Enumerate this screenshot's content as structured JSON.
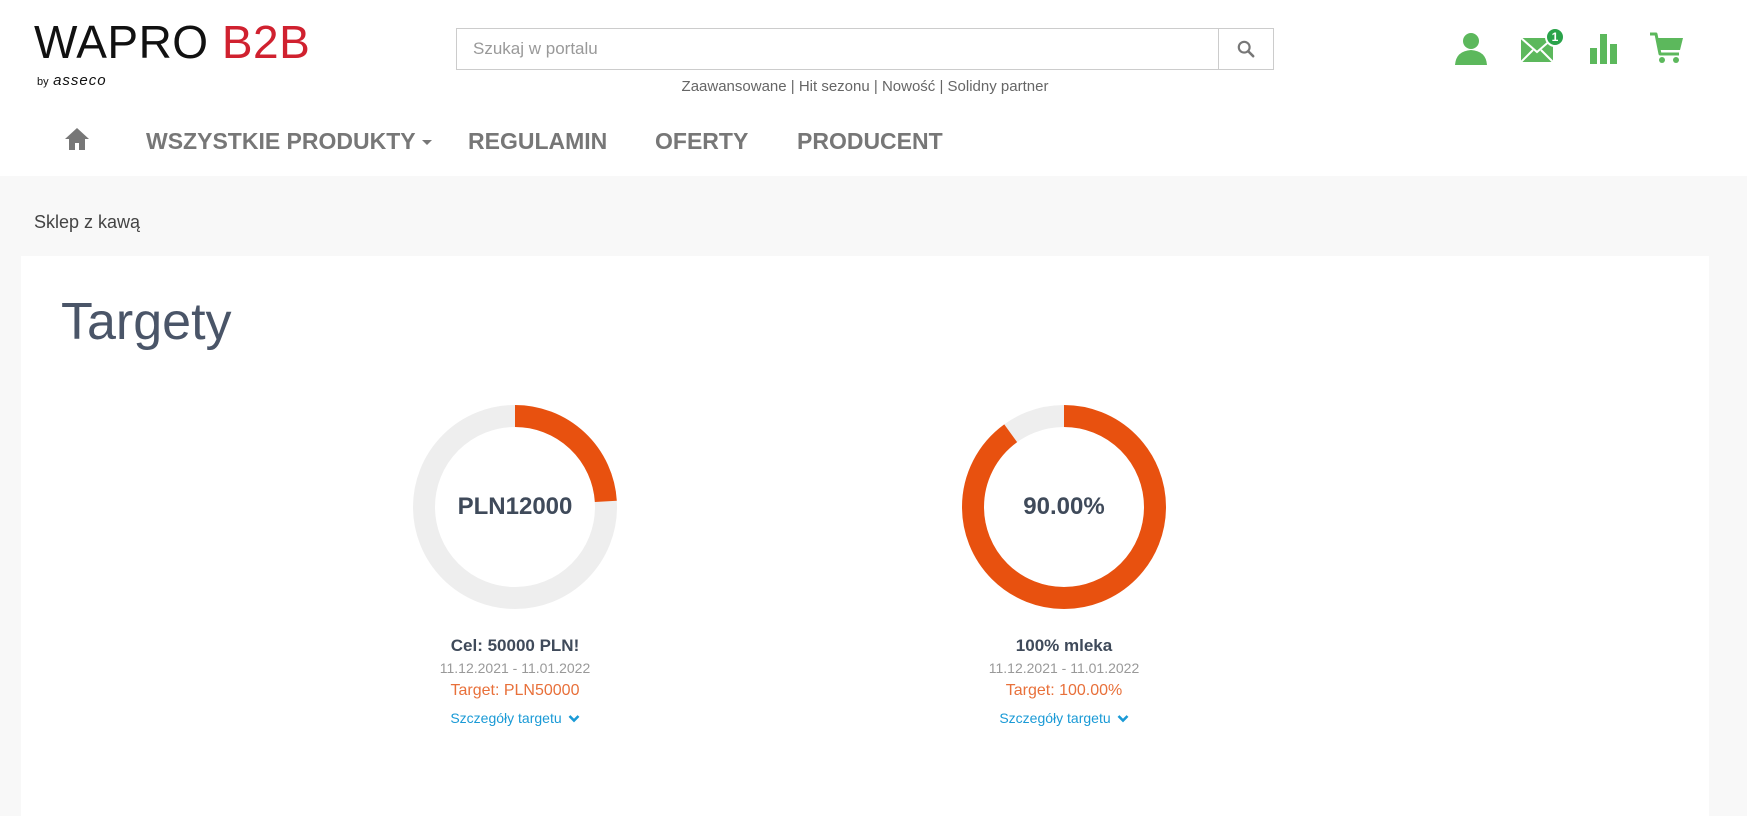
{
  "brand": {
    "name": "WAPRO",
    "accent": "B2B",
    "by": "by",
    "company": "asseco",
    "accent_color": "#d0212f"
  },
  "search": {
    "placeholder": "Szukaj w portalu",
    "value": ""
  },
  "quick_links": [
    {
      "label": "Zaawansowane"
    },
    {
      "label": "Hit sezonu"
    },
    {
      "label": "Nowość"
    },
    {
      "label": "Solidny partner"
    }
  ],
  "quick_links_separator": " | ",
  "header_icons": [
    {
      "icon": "user-icon"
    },
    {
      "icon": "mail-icon",
      "badge": "1"
    },
    {
      "icon": "bar-chart-icon"
    },
    {
      "icon": "cart-icon"
    }
  ],
  "icon_color": "#5cb85c",
  "nav": {
    "home_icon": "home-icon",
    "items": [
      {
        "label": "WSZYSTKIE PRODUKTY",
        "dropdown": true
      },
      {
        "label": "REGULAMIN"
      },
      {
        "label": "OFERTY"
      },
      {
        "label": "PRODUCENT"
      }
    ]
  },
  "breadcrumb": "Sklep z kawą",
  "page_title": "Targety",
  "progress_color": "#e8510f",
  "track_color": "#eeeeee",
  "targets": [
    {
      "center_label": "PLN12000",
      "progress": 0.24,
      "name": "Cel: 50000 PLN!",
      "dates": "11.12.2021 - 11.01.2022",
      "target_text": "Target: PLN50000",
      "details_label": "Szczegóły targetu"
    },
    {
      "center_label": "90.00%",
      "progress": 0.9,
      "name": "100% mleka",
      "dates": "11.12.2021 - 11.01.2022",
      "target_text": "Target: 100.00%",
      "details_label": "Szczegóły targetu"
    }
  ]
}
